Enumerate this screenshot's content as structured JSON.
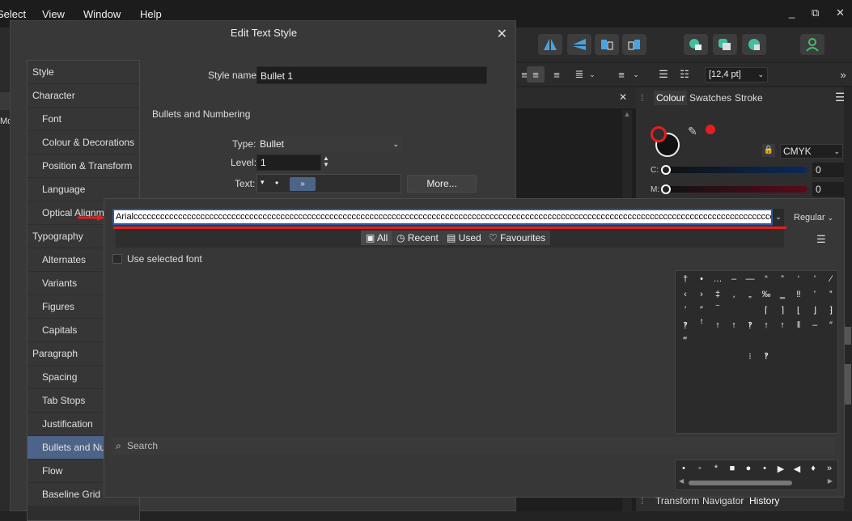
{
  "menu": [
    "Select",
    "View",
    "Window",
    "Help"
  ],
  "window_controls": [
    "_",
    "⧉",
    "✕"
  ],
  "dialog": {
    "title": "Edit Text Style",
    "close": "✕",
    "style_name_label": "Style name:",
    "style_name_value": "Bullet 1",
    "section": "Bullets and Numbering",
    "type_label": "Type:",
    "type_value": "Bullet",
    "level_label": "Level:",
    "level_value": "1",
    "text_label": "Text:",
    "text_bullet": "•",
    "more_button": "More...",
    "nav": [
      {
        "label": "Style",
        "sub": false
      },
      {
        "label": "Character",
        "sub": false
      },
      {
        "label": "Font",
        "sub": true
      },
      {
        "label": "Colour & Decorations",
        "sub": true
      },
      {
        "label": "Position & Transform",
        "sub": true
      },
      {
        "label": "Language",
        "sub": true
      },
      {
        "label": "Optical Alignment",
        "sub": true
      },
      {
        "label": "Typography",
        "sub": false
      },
      {
        "label": "Alternates",
        "sub": true
      },
      {
        "label": "Variants",
        "sub": true
      },
      {
        "label": "Figures",
        "sub": true
      },
      {
        "label": "Capitals",
        "sub": true
      },
      {
        "label": "Paragraph",
        "sub": false
      },
      {
        "label": "Spacing",
        "sub": true
      },
      {
        "label": "Tab Stops",
        "sub": true
      },
      {
        "label": "Justification",
        "sub": true
      },
      {
        "label": "Bullets and Numbering",
        "sub": true,
        "selected": true
      },
      {
        "label": "Flow",
        "sub": true
      },
      {
        "label": "Baseline Grid",
        "sub": true
      }
    ]
  },
  "glyph_popup": {
    "font_value": "Arialccccccccccccccccccccccccccccccccccccccccccccccccccccccccccccccccccccccccccccccccccccccccccccccccccccccccccccccccccccccccccccccccccccccccccccccccccccc",
    "weight": "Regular",
    "filters": [
      "All",
      "Recent",
      "Used",
      "Favourites"
    ],
    "use_selected_font": "Use selected font",
    "search_placeholder": "Search",
    "glyph_rows": [
      [
        "†",
        "•",
        "…",
        "–",
        "—",
        "“",
        "”",
        "‘",
        "’",
        "⁄"
      ],
      [
        "‹",
        "›",
        "‡",
        ",",
        "„",
        "‰",
        "‗",
        "‼",
        "‛",
        "‟"
      ],
      [
        "′",
        "″",
        "‾",
        "",
        "",
        "⌈",
        "⌉",
        "⌊",
        "⌋",
        "⁆"
      ],
      [
        "‽",
        "ꜝ",
        "↑",
        "↑",
        "‽",
        "↑",
        "↑",
        "‖",
        "‒",
        "″"
      ],
      [
        "‴",
        "",
        "",
        "",
        "",
        "",
        "",
        "",
        "",
        ""
      ],
      [
        "",
        "",
        "",
        "",
        "⁝",
        "‽",
        "",
        "",
        "",
        ""
      ]
    ],
    "bottom_glyphs": [
      "•",
      "◦",
      "*",
      "■",
      "●",
      "•",
      "▶",
      "◀",
      "♦",
      "»"
    ]
  },
  "right_panel": {
    "tabs": [
      "Colour",
      "Swatches",
      "Stroke"
    ],
    "color_model": "CMYK",
    "channels": [
      {
        "label": "C:",
        "value": "0"
      },
      {
        "label": "M:",
        "value": "0"
      }
    ],
    "bottom_tabs": [
      "Transform",
      "Navigator",
      "History"
    ],
    "size_value": "[12,4 pt]"
  },
  "colors": {
    "accent": "#4c6488",
    "highlight_red": "#e02020"
  }
}
